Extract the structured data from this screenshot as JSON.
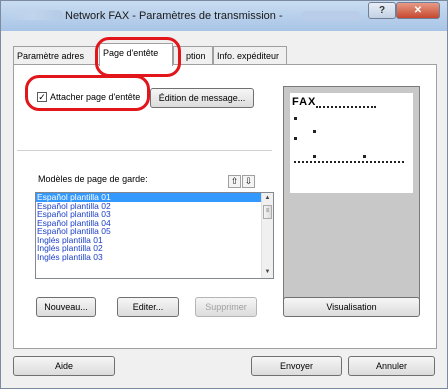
{
  "window": {
    "title": "Network FAX - Paramètres de transmission -",
    "help_glyph": "?",
    "close_glyph": "✕"
  },
  "tabs": [
    {
      "label": "Paramètre adres"
    },
    {
      "label": "Page d'entête"
    },
    {
      "label": "ption"
    },
    {
      "label": "Info. expéditeur"
    }
  ],
  "options": {
    "attach_cover_label": "Attacher page d'entête",
    "attach_cover_checked": true,
    "message_edit_label": "Édition de message..."
  },
  "templates": {
    "label": "Modèles de page de garde:",
    "items": [
      {
        "label": "Español plantilla 01"
      },
      {
        "label": "Español plantilla 02"
      },
      {
        "label": "Español plantilla 03"
      },
      {
        "label": "Español plantilla 04"
      },
      {
        "label": "Español plantilla 05"
      },
      {
        "label": "Inglés plantilla 01"
      },
      {
        "label": "Inglés plantilla 02"
      },
      {
        "label": "Inglés plantilla 03"
      }
    ]
  },
  "buttons": {
    "new": "Nouveau...",
    "edit": "Editer...",
    "delete": "Supprimer",
    "preview": "Visualisation",
    "help": "Aide",
    "send": "Envoyer",
    "cancel": "Annuler"
  },
  "preview_page": {
    "heading": "FAX"
  },
  "colors": {
    "highlight_ring": "#e2151b",
    "selection": "#3399ff",
    "list_text": "#1a3fc8"
  }
}
